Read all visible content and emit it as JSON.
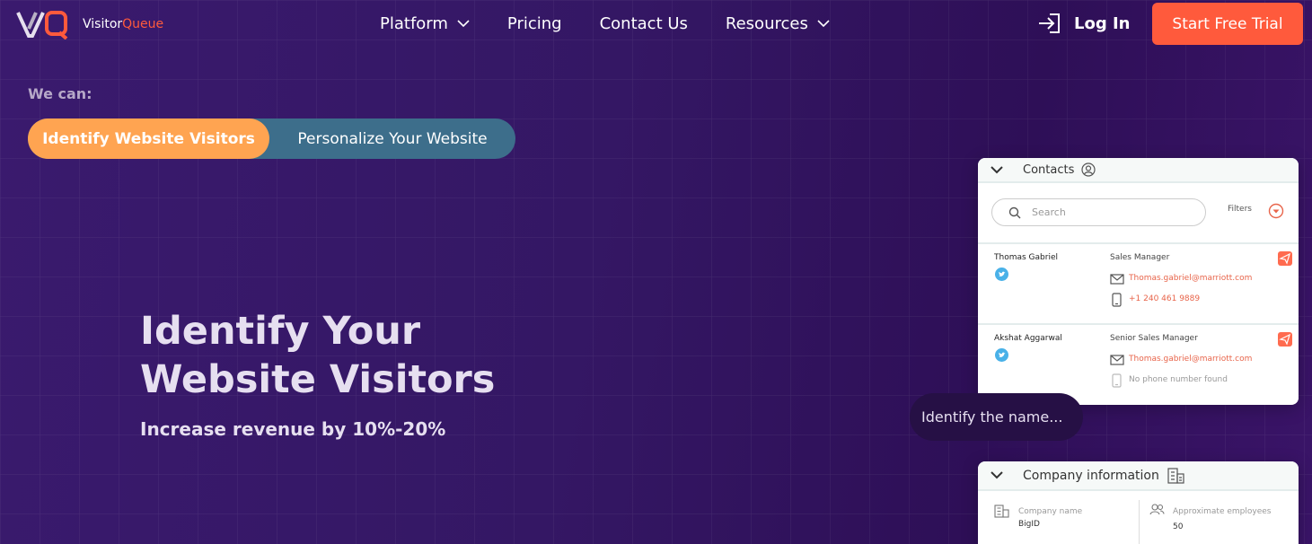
{
  "brand": {
    "logo_mark": "VQ",
    "name_part1": "Visitor",
    "name_part2": "Queue",
    "accent_color": "#ff5a3c"
  },
  "nav": {
    "items": [
      {
        "label": "Platform",
        "has_dropdown": true
      },
      {
        "label": "Pricing",
        "has_dropdown": false
      },
      {
        "label": "Contact Us",
        "has_dropdown": false
      },
      {
        "label": "Resources",
        "has_dropdown": true
      }
    ],
    "login_label": "Log In",
    "login_icon": "login-arrow-icon",
    "cta_label": "Start Free Trial"
  },
  "capabilities": {
    "heading": "We can:",
    "options": [
      {
        "label": "Identify Website Visitors",
        "active": true
      },
      {
        "label": "Personalize Your Website",
        "active": false
      }
    ]
  },
  "hero": {
    "title": "Identify Your Website Visitors",
    "subtitle": "Increase revenue by 10%-20%"
  },
  "contacts_panel": {
    "title": "Contacts",
    "search_placeholder": "Search",
    "filters_label": "Filters",
    "contacts": [
      {
        "name": "Thomas Gabriel",
        "role": "Sales Manager",
        "email": "Thomas.gabriel@marriott.com",
        "phone": "+1 240 461 9889",
        "has_phone": true
      },
      {
        "name": "Akshat Aggarwal",
        "role": "Senior Sales Manager",
        "email": "Thomas.gabriel@marriott.com",
        "phone": "No phone number found",
        "has_phone": false
      }
    ]
  },
  "bubble": {
    "text": "Identify the name..."
  },
  "company_panel": {
    "title": "Company information",
    "name_label": "Company name",
    "name_value": "BigID",
    "employees_label": "Approximate employees",
    "employees_value": "50"
  }
}
